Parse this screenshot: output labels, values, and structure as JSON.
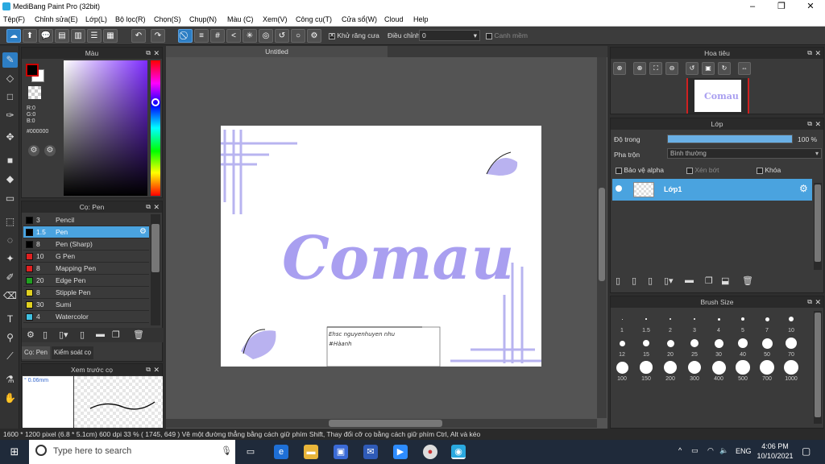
{
  "window": {
    "title": "MediBang Paint Pro (32bit)"
  },
  "menu": [
    "Tệp(F)",
    "Chỉnh sửa(E)",
    "Lớp(L)",
    "Bộ lọc(R)",
    "Chọn(S)",
    "Chụp(N)",
    "Màu (C)",
    "Xem(V)",
    "Công cụ(T)",
    "Cửa sổ(W)",
    "Cloud",
    "Help"
  ],
  "toolbar": {
    "antialias_label": "Khử răng cưa",
    "correction_label": "Điều chỉnh",
    "correction_value": "0",
    "snap_label": "Canh mềm"
  },
  "color_panel": {
    "title": "Màu",
    "r": "R:0",
    "g": "G:0",
    "b": "B:0",
    "hex": "#000000"
  },
  "brush_panel": {
    "title": "Cọ: Pen",
    "brushes": [
      {
        "size": "3",
        "name": "Pencil",
        "color": "#000000"
      },
      {
        "size": "1.5",
        "name": "Pen",
        "color": "#000000",
        "selected": true
      },
      {
        "size": "8",
        "name": "Pen (Sharp)",
        "color": "#000000"
      },
      {
        "size": "10",
        "name": "G Pen",
        "color": "#e02020"
      },
      {
        "size": "8",
        "name": "Mapping Pen",
        "color": "#e02020"
      },
      {
        "size": "20",
        "name": "Edge Pen",
        "color": "#20a020"
      },
      {
        "size": "8",
        "name": "Stipple Pen",
        "color": "#e0d020"
      },
      {
        "size": "30",
        "name": "Sumi",
        "color": "#e0d020"
      },
      {
        "size": "4",
        "name": "Watercolor",
        "color": "#40c0e0"
      }
    ],
    "tabs": [
      "Cọ: Pen",
      "Kiểm soát cọ"
    ]
  },
  "preview_panel": {
    "title": "Xem trước cọ",
    "size": "0.06mm"
  },
  "canvas": {
    "tab_title": "Untitled",
    "art_text": "Comau",
    "note_line1": "Ehsc nguyenhuyen nhu",
    "note_line2": "#Hàanh"
  },
  "nav_panel": {
    "title": "Hoa tiêu"
  },
  "layer_panel": {
    "title": "Lớp",
    "opacity_label": "Độ trong",
    "opacity_value": "100 %",
    "opacity": 1.0,
    "blend_label": "Pha trộn",
    "blend_value": "Bình thường",
    "protect_alpha": "Bảo vệ alpha",
    "clip": "Xén bớt",
    "lock": "Khóa",
    "layer_name": "Lớp1"
  },
  "size_panel": {
    "title": "Brush Size",
    "sizes": [
      "1",
      "1.5",
      "2",
      "3",
      "4",
      "5",
      "7",
      "10",
      "12",
      "15",
      "20",
      "25",
      "30",
      "40",
      "50",
      "70",
      "100",
      "150",
      "200",
      "300",
      "400",
      "500",
      "700",
      "1000"
    ]
  },
  "statusbar": {
    "text": "1600 * 1200 pixel   (6.8 * 5.1cm)  600 dpi   33 %   ( 1745, 649 )   Vẽ một đường thẳng bằng cách giữ phím Shift, Thay đổi cỡ cọ bằng cách giữ phím Ctrl, Alt và kéo"
  },
  "taskbar": {
    "search_placeholder": "Type here to search",
    "lang": "ENG",
    "time": "4:06 PM",
    "date": "10/10/2021"
  }
}
